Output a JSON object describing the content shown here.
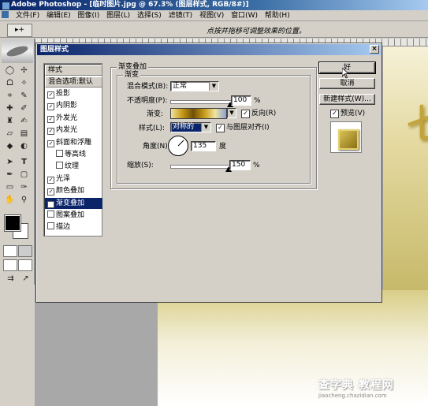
{
  "app": {
    "title": "Adobe Photoshop - [临时图片.jpg @ 67.3% (图层样式, RGB/8#)]"
  },
  "menu": [
    "文件(F)",
    "编辑(E)",
    "图像(I)",
    "图层(L)",
    "选择(S)",
    "滤镜(T)",
    "视图(V)",
    "窗口(W)",
    "帮助(H)"
  ],
  "options_bar": {
    "tool_label": "▸+",
    "hint": "点按并拖移可调整效果的位置。"
  },
  "dialog": {
    "title": "图层样式",
    "close": "×",
    "styles_header": "样式",
    "blend_options": "混合选项:默认",
    "items": [
      {
        "label": "投影",
        "checked": true
      },
      {
        "label": "内阴影",
        "checked": true
      },
      {
        "label": "外发光",
        "checked": true
      },
      {
        "label": "内发光",
        "checked": true
      },
      {
        "label": "斜面和浮雕",
        "checked": true
      },
      {
        "label": "等高线",
        "checked": false
      },
      {
        "label": "纹理",
        "checked": false
      },
      {
        "label": "光泽",
        "checked": true
      },
      {
        "label": "颜色叠加",
        "checked": true
      },
      {
        "label": "渐变叠加",
        "checked": true
      },
      {
        "label": "图案叠加",
        "checked": false
      },
      {
        "label": "描边",
        "checked": false
      }
    ],
    "panel": {
      "group_title": "渐变叠加",
      "sub_title": "渐变",
      "blend_mode_label": "混合模式(B):",
      "blend_mode_value": "正常",
      "opacity_label": "不透明度(P):",
      "opacity_value": "100",
      "opacity_fraction": 1.0,
      "percent": "%",
      "gradient_label": "渐变:",
      "reverse_label": "反向(R)",
      "reverse_checked": true,
      "style_label": "样式(L):",
      "style_value": "对称的",
      "align_label": "与图层对齐(I)",
      "align_checked": true,
      "angle_label": "角度(N):",
      "angle_value": "135",
      "angle_unit": "度",
      "scale_label": "缩放(S):",
      "scale_value": "150",
      "scale_fraction": 1.0
    },
    "buttons": {
      "ok": "好",
      "cancel": "取消",
      "new_style": "新建样式(W)...",
      "preview": "预览(V)"
    },
    "preview_checked": true,
    "colors": {
      "gradient_stops": [
        "#f0e4a0",
        "#c89a18",
        "#705008",
        "#c89a18",
        "#f0e4a0",
        "#8aa0d8"
      ]
    }
  },
  "watermark": {
    "main": "查字典 教程网",
    "sub": "jiaocheng.chazidian.com"
  },
  "canvas_glyph": "七"
}
